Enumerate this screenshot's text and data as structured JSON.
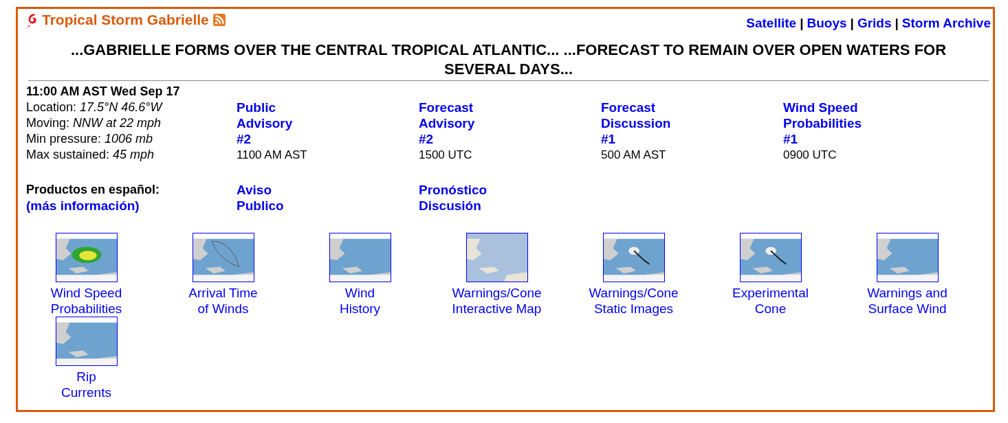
{
  "header": {
    "title": "Tropical Storm Gabrielle",
    "links": [
      {
        "kind": "link",
        "text": "Satellite"
      },
      {
        "kind": "separator",
        "text": "|"
      },
      {
        "kind": "link",
        "text": "Buoys"
      },
      {
        "kind": "separator",
        "text": "|"
      },
      {
        "kind": "link",
        "text": "Grids"
      },
      {
        "kind": "separator",
        "text": "|"
      },
      {
        "kind": "link",
        "text": "Storm Archive"
      }
    ]
  },
  "headline": "...GABRIELLE FORMS OVER THE CENTRAL TROPICAL ATLANTIC... ...FORECAST TO REMAIN OVER OPEN WATERS FOR SEVERAL DAYS...",
  "summary": {
    "time": "11:00 AM AST Wed Sep 17",
    "facts": [
      {
        "label": "Location:",
        "value": "17.5°N 46.6°W"
      },
      {
        "label": "Moving:",
        "value": "NNW at 22 mph"
      },
      {
        "label": "Min pressure:",
        "value": "1006 mb"
      },
      {
        "label": "Max sustained:",
        "value": "45 mph"
      }
    ]
  },
  "products": [
    {
      "lines": [
        "Public",
        "Advisory",
        "#2"
      ],
      "issued": "1100 AM AST"
    },
    {
      "lines": [
        "Forecast",
        "Advisory",
        "#2"
      ],
      "issued": "1500 UTC"
    },
    {
      "lines": [
        "Forecast",
        "Discussion",
        "#1"
      ],
      "issued": "500 AM AST"
    },
    {
      "lines": [
        "Wind Speed",
        "Probabilities",
        "#1"
      ],
      "issued": "0900 UTC"
    }
  ],
  "spanish": {
    "label": "Productos en español:",
    "more_link": "(más información)",
    "products": [
      {
        "lines": [
          "Aviso",
          "Publico"
        ]
      },
      {
        "lines": [
          "Pronóstico",
          "Discusión"
        ]
      }
    ]
  },
  "graphics": [
    {
      "lines": [
        "Wind Speed",
        "Probabilities"
      ]
    },
    {
      "lines": [
        "Arrival Time",
        "of Winds"
      ]
    },
    {
      "lines": [
        "Wind",
        "History"
      ]
    },
    {
      "lines": [
        "Warnings/Cone",
        "Interactive Map"
      ]
    },
    {
      "lines": [
        "Warnings/Cone",
        "Static Images"
      ]
    },
    {
      "lines": [
        "Experimental",
        "Cone"
      ]
    },
    {
      "lines": [
        "Warnings and",
        "Surface Wind"
      ]
    },
    {
      "lines": [
        "Rip",
        "Currents"
      ]
    }
  ]
}
